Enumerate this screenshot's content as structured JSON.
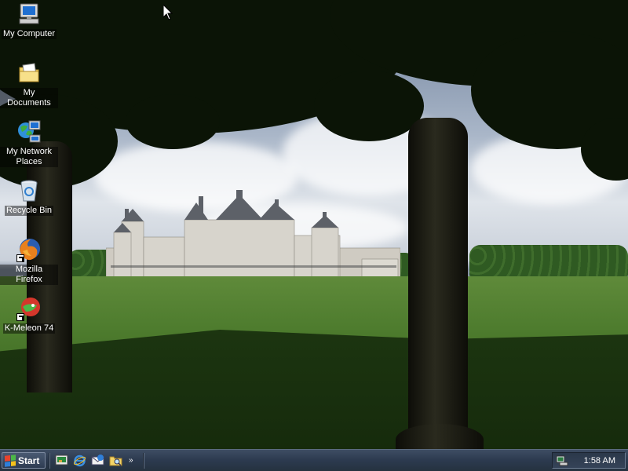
{
  "desktop": {
    "icons": [
      {
        "label": "My Computer",
        "icon": "computer-icon"
      },
      {
        "label": "My Documents",
        "icon": "folder-icon"
      },
      {
        "label": "My Network Places",
        "icon": "network-icon"
      },
      {
        "label": "Recycle Bin",
        "icon": "recycle-bin-icon"
      },
      {
        "label": "Mozilla Firefox",
        "icon": "firefox-icon",
        "shortcut": true
      },
      {
        "label": "K-Meleon 74",
        "icon": "k-meleon-icon",
        "shortcut": true
      }
    ]
  },
  "taskbar": {
    "start_label": "Start",
    "quick_launch": [
      "show-desktop-icon",
      "internet-explorer-icon",
      "outlook-express-icon",
      "folder-search-icon"
    ],
    "more_label": "»",
    "tray": {
      "icons": [
        "network-tray-icon"
      ],
      "clock": "1:58 AM"
    }
  },
  "colors": {
    "taskbar": "#2c3a4f",
    "icon_label_bg": "#000000",
    "grass": "#4e7c2e"
  }
}
